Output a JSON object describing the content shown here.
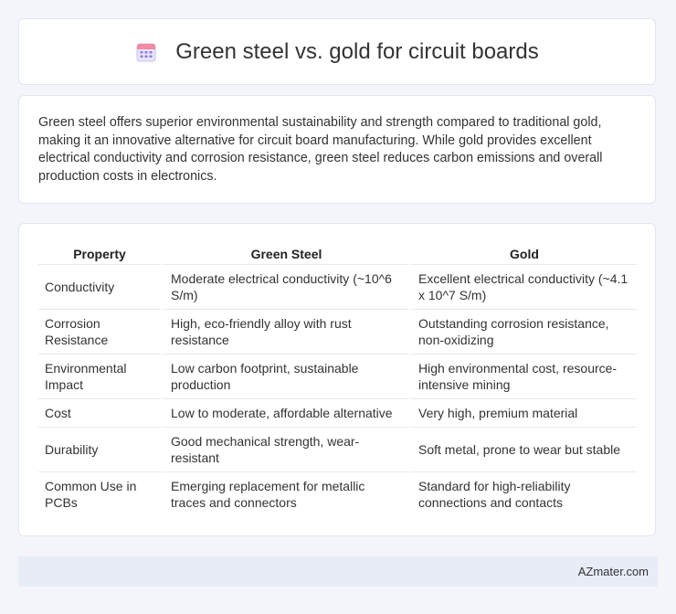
{
  "header": {
    "title": "Green steel vs. gold for circuit boards",
    "icon": "calendar-icon"
  },
  "intro": {
    "text": "Green steel offers superior environmental sustainability and strength compared to traditional gold, making it an innovative alternative for circuit board manufacturing. While gold provides excellent electrical conductivity and corrosion resistance, green steel reduces carbon emissions and overall production costs in electronics."
  },
  "table": {
    "headers": [
      "Property",
      "Green Steel",
      "Gold"
    ],
    "rows": [
      [
        "Conductivity",
        "Moderate electrical conductivity (~10^6 S/m)",
        "Excellent electrical conductivity (~4.1 x 10^7 S/m)"
      ],
      [
        "Corrosion Resistance",
        "High, eco-friendly alloy with rust resistance",
        "Outstanding corrosion resistance, non-oxidizing"
      ],
      [
        "Environmental Impact",
        "Low carbon footprint, sustainable production",
        "High environmental cost, resource-intensive mining"
      ],
      [
        "Cost",
        "Low to moderate, affordable alternative",
        "Very high, premium material"
      ],
      [
        "Durability",
        "Good mechanical strength, wear-resistant",
        "Soft metal, prone to wear but stable"
      ],
      [
        "Common Use in PCBs",
        "Emerging replacement for metallic traces and connectors",
        "Standard for high-reliability connections and contacts"
      ]
    ]
  },
  "footer": {
    "site": "AZmater.com"
  }
}
